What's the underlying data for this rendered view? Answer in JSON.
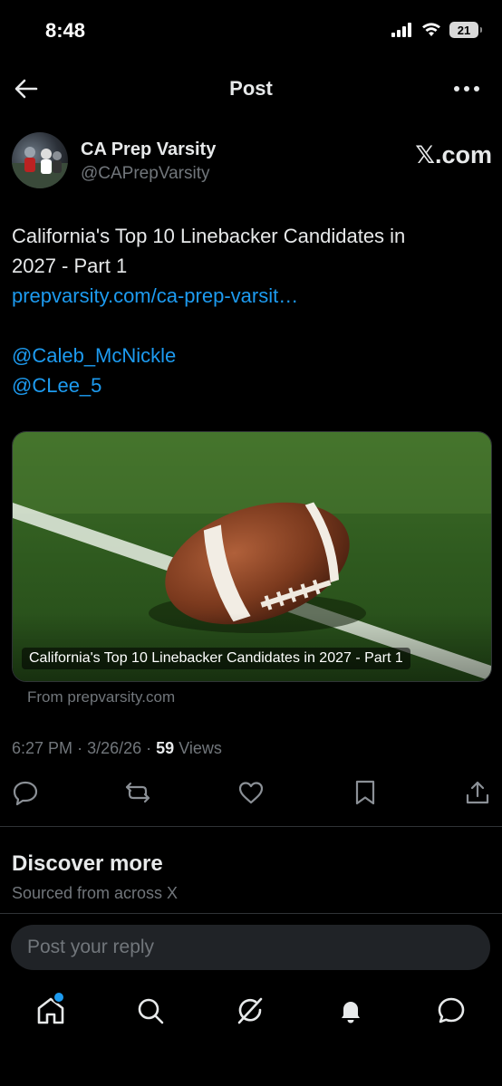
{
  "status_bar": {
    "time": "8:48",
    "battery": "21"
  },
  "header": {
    "title": "Post"
  },
  "post": {
    "author_name": "CA Prep Varsity",
    "author_handle": "@CAPrepVarsity",
    "source_label": "𝕏.com",
    "text_line1": "California's Top 10 Linebacker Candidates in",
    "text_line2": "2027 - Part 1",
    "link": "prepvarsity.com/ca-prep-varsit…",
    "mention1": "@Caleb_McNickle",
    "mention2": "@CLee_5",
    "card_caption": "California's Top 10 Linebacker Candidates in 2027 - Part 1",
    "card_domain": "From prepvarsity.com",
    "time": "6:27 PM",
    "date": "3/26/26",
    "views_count": "59",
    "views_label": "Views"
  },
  "discover": {
    "title": "Discover more",
    "subtitle": "Sourced from across X"
  },
  "reply": {
    "placeholder": "Post your reply"
  },
  "icons": {
    "back": "arrow-left-icon",
    "more": "more-horizontal-icon",
    "reply": "reply-icon",
    "repost": "repost-icon",
    "like": "heart-icon",
    "bookmark": "bookmark-icon",
    "share": "share-icon",
    "home": "home-icon",
    "search": "search-icon",
    "grok": "grok-icon",
    "notifications": "bell-icon",
    "messages": "message-icon"
  },
  "colors": {
    "background": "#000000",
    "text": "#e7e9ea",
    "muted": "#71767b",
    "link": "#1d9bf0"
  }
}
